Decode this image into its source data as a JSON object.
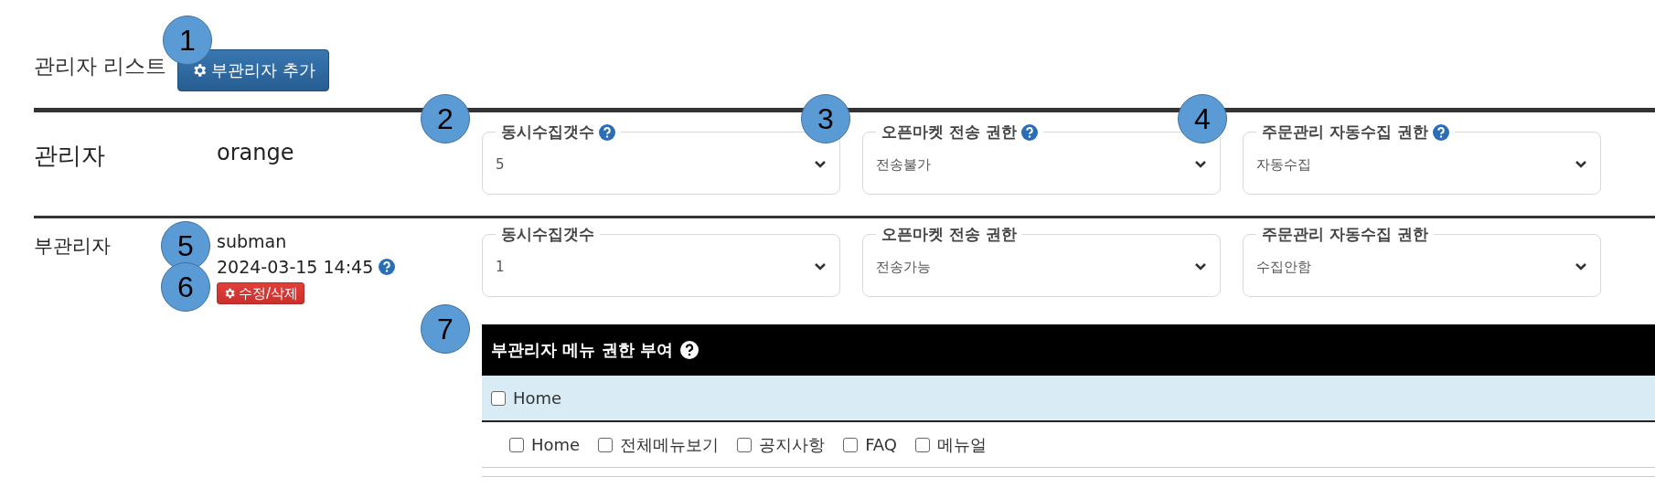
{
  "header": {
    "title": "관리자 리스트",
    "add_button": "부관리자 추가"
  },
  "admin": {
    "role": "관리자",
    "name": "orange",
    "fields": [
      {
        "label": "동시수집갯수",
        "help": true,
        "value": "5"
      },
      {
        "label": "오픈마켓 전송 권한",
        "help": true,
        "value": "전송불가"
      },
      {
        "label": "주문관리 자동수집 권한",
        "help": true,
        "value": "자동수집"
      }
    ]
  },
  "sub_admin": {
    "role": "부관리자",
    "name": "subman",
    "date": "2024-03-15 14:45",
    "date_help": true,
    "edit_button": "수정/삭제",
    "fields": [
      {
        "label": "동시수집갯수",
        "help": false,
        "value": "1"
      },
      {
        "label": "오픈마켓 전송 권한",
        "help": false,
        "value": "전송가능"
      },
      {
        "label": "주문관리 자동수집 권한",
        "help": false,
        "value": "수집안함"
      }
    ],
    "menu_permissions": {
      "title": "부관리자 메뉴 권한 부여",
      "help": true,
      "group": {
        "label": "Home",
        "checked": false
      },
      "items": [
        {
          "label": "Home",
          "checked": false
        },
        {
          "label": "전체메뉴보기",
          "checked": false
        },
        {
          "label": "공지사항",
          "checked": false
        },
        {
          "label": "FAQ",
          "checked": false
        },
        {
          "label": "메뉴얼",
          "checked": false
        }
      ]
    }
  },
  "callouts": [
    "1",
    "2",
    "3",
    "4",
    "5",
    "6",
    "7"
  ]
}
